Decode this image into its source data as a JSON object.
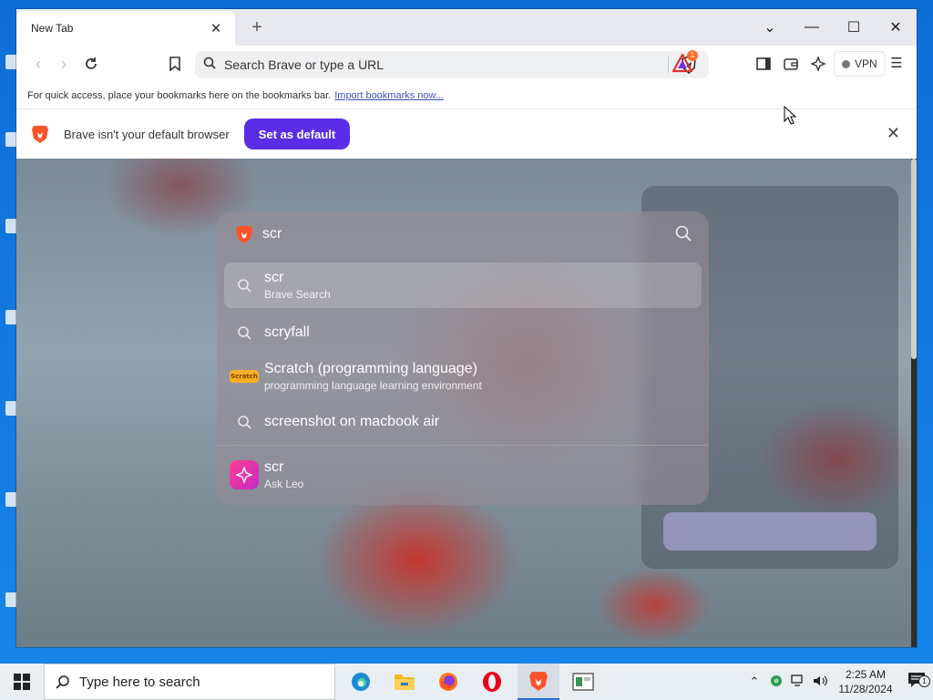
{
  "colors": {
    "brave_purple": "#5a2ee6",
    "brave_orange": "#fb542b",
    "link_blue": "#3b51c9",
    "desktop_blue": "#1173d9",
    "taskbar": "#e9eef3"
  },
  "tab": {
    "title": "New Tab"
  },
  "toolbar": {
    "url_placeholder": "Search Brave or type a URL",
    "rewards_badge": "1",
    "vpn_label": "VPN"
  },
  "bookmarks_bar": {
    "message": "For quick access, place your bookmarks here on the bookmarks bar.",
    "import_link": "Import bookmarks now..."
  },
  "infobar": {
    "message": "Brave isn't your default browser",
    "button": "Set as default"
  },
  "omnibox": {
    "query": "scr",
    "suggestions": [
      {
        "icon": "search-icon",
        "title": "scr",
        "subtitle": "Brave Search",
        "selected": true
      },
      {
        "icon": "search-icon",
        "title": "scryfall",
        "subtitle": ""
      },
      {
        "icon": "scratch-logo-icon",
        "title": "Scratch (programming language)",
        "subtitle": "programming language learning environment"
      },
      {
        "icon": "search-icon",
        "title": "screenshot on macbook air",
        "subtitle": ""
      },
      {
        "icon": "leo-icon",
        "title": "scr",
        "subtitle": "Ask Leo"
      }
    ]
  },
  "taskbar": {
    "search_placeholder": "Type here to search",
    "apps": [
      "edge-icon",
      "file-explorer-icon",
      "firefox-icon",
      "opera-icon",
      "brave-icon",
      "app-window-icon"
    ],
    "time": "2:25 AM",
    "date": "11/28/2024",
    "notification_count": "1"
  }
}
